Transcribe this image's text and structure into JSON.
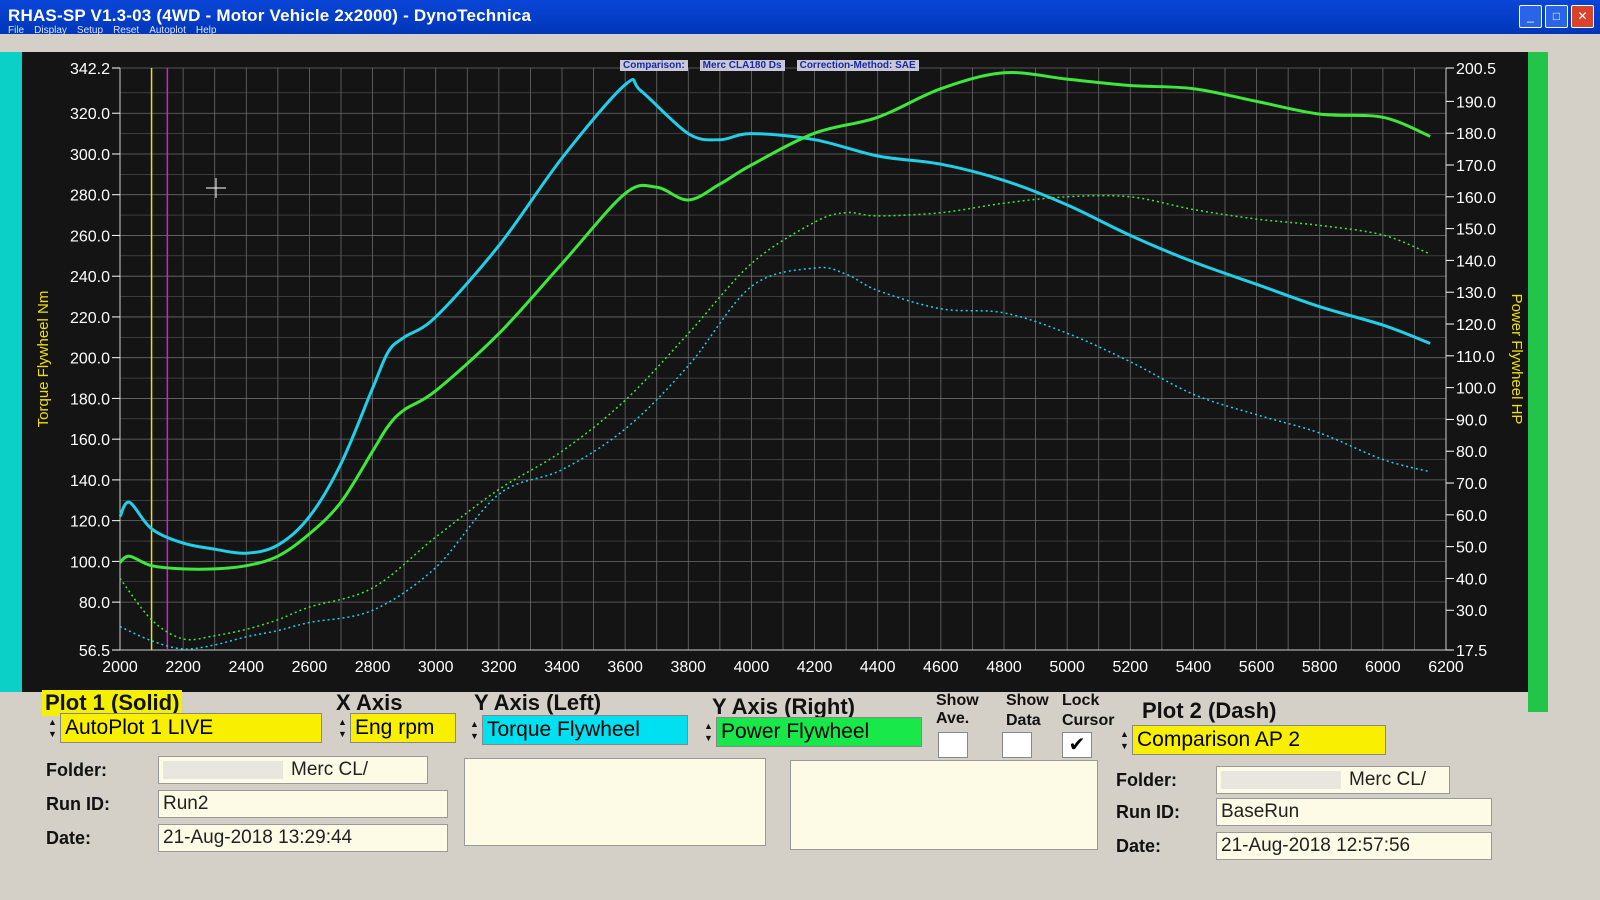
{
  "window": {
    "title": "RHAS-SP V1.3-03  (4WD - Motor Vehicle 2x2000) - DynoTechnica",
    "menu": [
      "File",
      "Display",
      "Setup",
      "Reset",
      "Autoplot",
      "Help"
    ]
  },
  "info": {
    "comparison": "Comparison:",
    "vehicle": "Merc CLA180 Ds",
    "correction": "Correction-Method: SAE"
  },
  "chart_data": {
    "type": "line",
    "xlabel": "",
    "ylabel": "Torque Flywheel Nm",
    "y2label": "Power Flywheel HP",
    "xlim": [
      2000,
      6200
    ],
    "ylim": [
      56.5,
      342.2
    ],
    "y2lim": [
      17.5,
      200.5
    ],
    "x_ticks": [
      "2000",
      "2200",
      "2400",
      "2600",
      "2800",
      "3000",
      "3200",
      "3400",
      "3600",
      "3800",
      "4000",
      "4200",
      "4400",
      "4600",
      "4800",
      "5000",
      "5200",
      "5400",
      "5600",
      "5800",
      "6000",
      "6200"
    ],
    "y_ticks": [
      "56.5",
      "80.0",
      "100.0",
      "120.0",
      "140.0",
      "160.0",
      "180.0",
      "200.0",
      "220.0",
      "240.0",
      "260.0",
      "280.0",
      "300.0",
      "320.0",
      "342.2"
    ],
    "y2_ticks": [
      "17.5",
      "30.0",
      "40.0",
      "50.0",
      "60.0",
      "70.0",
      "80.0",
      "90.0",
      "100.0",
      "110.0",
      "120.0",
      "130.0",
      "140.0",
      "150.0",
      "160.0",
      "170.0",
      "180.0",
      "190.0",
      "200.5"
    ],
    "grid": true,
    "cursor_rpm": [
      2100,
      2150
    ],
    "series": [
      {
        "name": "Torque Flywheel",
        "axis": "left",
        "style": "solid",
        "color": "#22cfe8",
        "x": [
          2000,
          2030,
          2100,
          2200,
          2300,
          2400,
          2500,
          2600,
          2700,
          2800,
          2850,
          2900,
          3000,
          3200,
          3400,
          3600,
          3650,
          3800,
          3900,
          4000,
          4200,
          4400,
          4600,
          4800,
          5000,
          5200,
          5400,
          5600,
          5800,
          6000,
          6150
        ],
        "y": [
          122,
          129,
          116,
          109,
          106,
          104,
          108,
          122,
          148,
          185,
          203,
          210,
          220,
          255,
          298,
          334,
          331,
          310,
          307,
          310,
          307,
          299,
          295,
          287,
          275,
          260,
          247,
          236,
          225,
          216,
          207
        ]
      },
      {
        "name": "Power Flywheel",
        "axis": "right",
        "style": "solid",
        "color": "#3ee83a",
        "x": [
          2000,
          2030,
          2100,
          2200,
          2300,
          2400,
          2500,
          2600,
          2700,
          2800,
          2850,
          2900,
          3000,
          3200,
          3400,
          3600,
          3700,
          3800,
          3900,
          4000,
          4200,
          4400,
          4600,
          4800,
          5000,
          5200,
          5400,
          5600,
          5800,
          6000,
          6150
        ],
        "y": [
          45,
          47,
          44,
          43,
          43,
          44,
          47,
          54,
          64,
          80,
          88,
          93,
          99,
          117,
          139,
          161,
          163,
          159,
          164,
          170,
          180,
          185,
          194,
          199,
          197,
          195,
          194,
          190,
          186,
          185,
          179
        ]
      },
      {
        "name": "Torque Flywheel",
        "axis": "left",
        "style": "dash",
        "color": "#22cfe8",
        "x": [
          2000,
          2100,
          2200,
          2300,
          2400,
          2500,
          2600,
          2800,
          3000,
          3200,
          3400,
          3600,
          3800,
          4000,
          4200,
          4300,
          4400,
          4600,
          4800,
          5000,
          5200,
          5400,
          5600,
          5800,
          6000,
          6150
        ],
        "y": [
          68,
          61,
          57,
          59,
          63,
          66,
          70,
          76,
          97,
          133,
          145,
          165,
          196,
          235,
          244,
          241,
          233,
          224,
          222,
          212,
          198,
          182,
          172,
          163,
          150,
          144
        ]
      },
      {
        "name": "Power Flywheel",
        "axis": "right",
        "style": "dash",
        "color": "#3ee83a",
        "x": [
          2000,
          2100,
          2200,
          2300,
          2400,
          2500,
          2600,
          2800,
          3000,
          3200,
          3400,
          3600,
          3800,
          4000,
          4200,
          4300,
          4400,
          4600,
          4800,
          5000,
          5200,
          5400,
          5600,
          5800,
          6000,
          6150
        ],
        "y": [
          40,
          27,
          21,
          22,
          24,
          27,
          31,
          37,
          53,
          68,
          80,
          96,
          117,
          139,
          152,
          155,
          154,
          155,
          158,
          160,
          160,
          156,
          153,
          151,
          148,
          142
        ]
      }
    ]
  },
  "panel": {
    "plot1_label": "Plot 1 (Solid)",
    "xaxis_label": "X Axis",
    "yleft_label": "Y Axis (Left)",
    "yright_label": "Y Axis (Right)",
    "show_ave_label1": "Show",
    "show_ave_label2": "Ave.",
    "show_data_label1": "Show",
    "show_data_label2": "Data",
    "lock_cursor_label1": "Lock",
    "lock_cursor_label2": "Cursor",
    "plot2_label": "Plot 2 (Dash)",
    "plot1_select": "AutoPlot 1 LIVE",
    "xaxis_select": "Eng rpm",
    "yleft_select": "Torque Flywheel",
    "yright_select": "Power Flywheel",
    "plot2_select": "Comparison AP 2",
    "show_ave_checked": false,
    "show_data_checked": false,
    "lock_cursor_checked": true,
    "lock_cursor_mark": "✔",
    "folder_label": "Folder:",
    "runid_label": "Run ID:",
    "date_label": "Date:",
    "plot1_folder": "Merc CL/",
    "plot1_runid": "Run2",
    "plot1_date": "21-Aug-2018   13:29:44",
    "plot2_folder": "Merc CL/",
    "plot2_runid": "BaseRun",
    "plot2_date": "21-Aug-2018   12:57:56"
  }
}
